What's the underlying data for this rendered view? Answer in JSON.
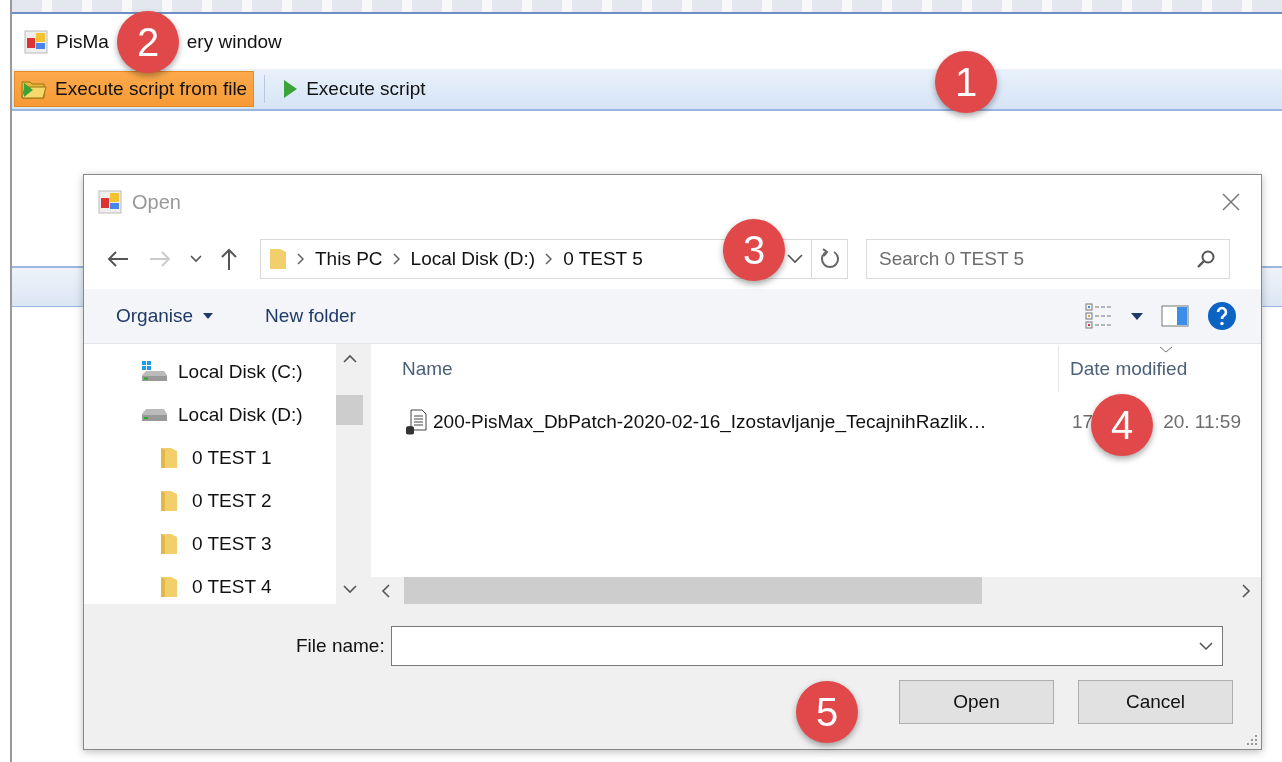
{
  "main_window": {
    "title_parts": [
      "PisMa",
      "ery window"
    ],
    "toolbar": [
      {
        "label": "Execute script from file",
        "kind": "open-file",
        "selected": true
      },
      {
        "label": "Execute script",
        "kind": "run",
        "selected": false
      }
    ]
  },
  "dialog": {
    "title": "Open",
    "breadcrumb": [
      "This PC",
      "Local Disk (D:)",
      "0 TEST 5"
    ],
    "search": {
      "placeholder": "Search 0 TEST 5"
    },
    "commands": [
      {
        "label": "Organise",
        "has_menu": true
      },
      {
        "label": "New folder",
        "has_menu": false
      }
    ],
    "nav": [
      {
        "label": "Local Disk (C:)",
        "kind": "system-drive"
      },
      {
        "label": "Local Disk (D:)",
        "kind": "drive",
        "children": [
          {
            "label": "0 TEST 1",
            "kind": "folder"
          },
          {
            "label": "0 TEST 2",
            "kind": "folder"
          },
          {
            "label": "0 TEST 3",
            "kind": "folder"
          },
          {
            "label": "0 TEST 4",
            "kind": "folder"
          }
        ]
      }
    ],
    "columns": [
      {
        "label": "Name",
        "sorted": false
      },
      {
        "label": "Date modified",
        "sorted": true
      }
    ],
    "files": [
      {
        "name": "200-PisMax_DbPatch-2020-02-16_Izostavljanje_TecajnihRazlik…",
        "date_parts": [
          "17",
          "20. 11:59"
        ]
      }
    ],
    "file_name": {
      "label": "File name:"
    },
    "buttons": [
      "Open",
      "Cancel"
    ]
  },
  "annotations": [
    "1",
    "2",
    "3",
    "4",
    "5"
  ]
}
